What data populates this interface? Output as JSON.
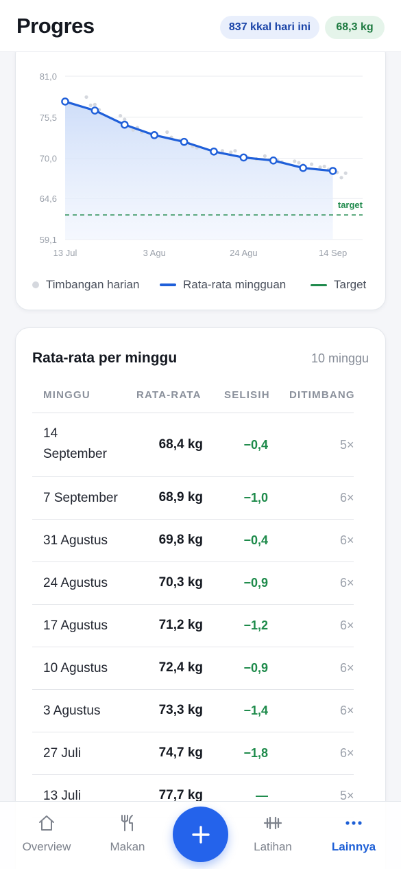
{
  "header": {
    "title": "Progres",
    "kcal_pill": "837 kkal hari ini",
    "weight_pill": "68,3 kg"
  },
  "chart_data": {
    "type": "line",
    "y_ticks": [
      "81,0",
      "75,5",
      "70,0",
      "64,6",
      "59,1"
    ],
    "y_tick_values": [
      81.0,
      75.5,
      70.0,
      64.6,
      59.1
    ],
    "ylim": [
      59.1,
      81.0
    ],
    "x_ticks": [
      "13 Jul",
      "3 Agu",
      "24 Agu",
      "14 Sep"
    ],
    "target_label": "target",
    "target_value": 62.4,
    "series": [
      {
        "name": "Rata-rata mingguan",
        "color": "#1f5fd9",
        "x_days": [
          0,
          7,
          14,
          21,
          28,
          35,
          42,
          49,
          56,
          63
        ],
        "values": [
          77.6,
          76.4,
          74.5,
          73.1,
          72.2,
          70.9,
          70.1,
          69.7,
          68.7,
          68.3
        ]
      },
      {
        "name": "Timbangan harian",
        "color": "#d5d8de",
        "x_days": [
          5,
          6,
          7,
          8,
          13,
          14,
          16,
          17,
          18,
          21,
          24,
          25,
          27,
          29,
          30,
          31,
          35,
          37,
          39,
          40,
          43,
          45,
          47,
          48,
          50,
          51,
          54,
          55,
          56,
          58,
          60,
          61,
          62,
          64,
          65,
          66
        ],
        "values": [
          78.2,
          77.1,
          77.2,
          76.5,
          75.7,
          75.2,
          73.8,
          74.1,
          73.5,
          73.1,
          73.5,
          72.8,
          72.4,
          72.0,
          71.6,
          71.4,
          71.2,
          71.0,
          70.8,
          71.0,
          70.1,
          69.9,
          70.3,
          69.8,
          69.7,
          69.5,
          69.6,
          69.4,
          69.1,
          69.2,
          68.8,
          68.9,
          68.5,
          68.1,
          67.4,
          68.0
        ]
      },
      {
        "name": "Target",
        "color": "#1f8a4c",
        "values": [
          62.4
        ]
      }
    ]
  },
  "legend": {
    "daily": "Timbangan harian",
    "weekly": "Rata-rata mingguan",
    "target": "Target"
  },
  "table": {
    "title": "Rata-rata per minggu",
    "count": "10 minggu",
    "headers": [
      "MINGGU",
      "RATA-RATA",
      "SELISIH",
      "DITIMBANG"
    ],
    "rows": [
      {
        "week": "14 September",
        "avg": "68,4 kg",
        "diff": "−0,4",
        "count": "5×"
      },
      {
        "week": "7 September",
        "avg": "68,9 kg",
        "diff": "−1,0",
        "count": "6×"
      },
      {
        "week": "31 Agustus",
        "avg": "69,8 kg",
        "diff": "−0,4",
        "count": "6×"
      },
      {
        "week": "24 Agustus",
        "avg": "70,3 kg",
        "diff": "−0,9",
        "count": "6×"
      },
      {
        "week": "17 Agustus",
        "avg": "71,2 kg",
        "diff": "−1,2",
        "count": "6×"
      },
      {
        "week": "10 Agustus",
        "avg": "72,4 kg",
        "diff": "−0,9",
        "count": "6×"
      },
      {
        "week": "3 Agustus",
        "avg": "73,3 kg",
        "diff": "−1,4",
        "count": "6×"
      },
      {
        "week": "27 Juli",
        "avg": "74,7 kg",
        "diff": "−1,8",
        "count": "6×"
      },
      {
        "week": "13 Juli",
        "avg": "77,7 kg",
        "diff": "—",
        "count": "5×"
      }
    ]
  },
  "nav": {
    "items": [
      {
        "label": "Overview",
        "icon": "home-icon"
      },
      {
        "label": "Makan",
        "icon": "fork-knife-icon"
      },
      {
        "label": "Latihan",
        "icon": "dumbbell-icon"
      },
      {
        "label": "Lainnya",
        "icon": "more-dots-icon"
      }
    ],
    "fab_icon": "plus-icon"
  },
  "colors": {
    "accent": "#2463eb",
    "success": "#1d8a4a",
    "muted": "#868c97"
  }
}
